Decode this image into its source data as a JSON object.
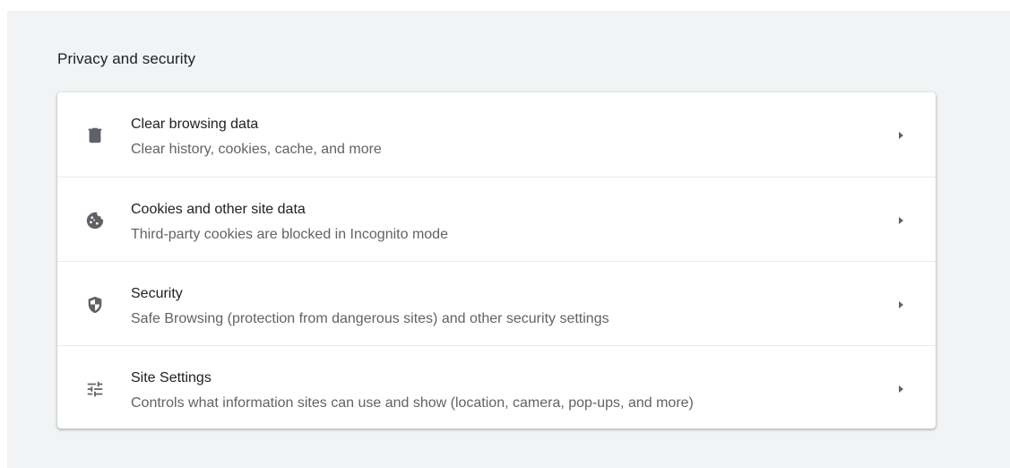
{
  "section": {
    "title": "Privacy and security"
  },
  "rows": [
    {
      "icon": "trash-icon",
      "label": "Clear browsing data",
      "sublabel": "Clear history, cookies, cache, and more"
    },
    {
      "icon": "cookie-icon",
      "label": "Cookies and other site data",
      "sublabel": "Third-party cookies are blocked in Incognito mode"
    },
    {
      "icon": "shield-icon",
      "label": "Security",
      "sublabel": "Safe Browsing (protection from dangerous sites) and other security settings"
    },
    {
      "icon": "tune-icon",
      "label": "Site Settings",
      "sublabel": "Controls what information sites can use and show (location, camera, pop-ups, and more)"
    }
  ],
  "colors": {
    "background": "#f1f3f4",
    "card": "#ffffff",
    "primary_text": "#202124",
    "secondary_text": "#5f6368",
    "icon": "#5f6368",
    "divider": "#e8eaed"
  }
}
